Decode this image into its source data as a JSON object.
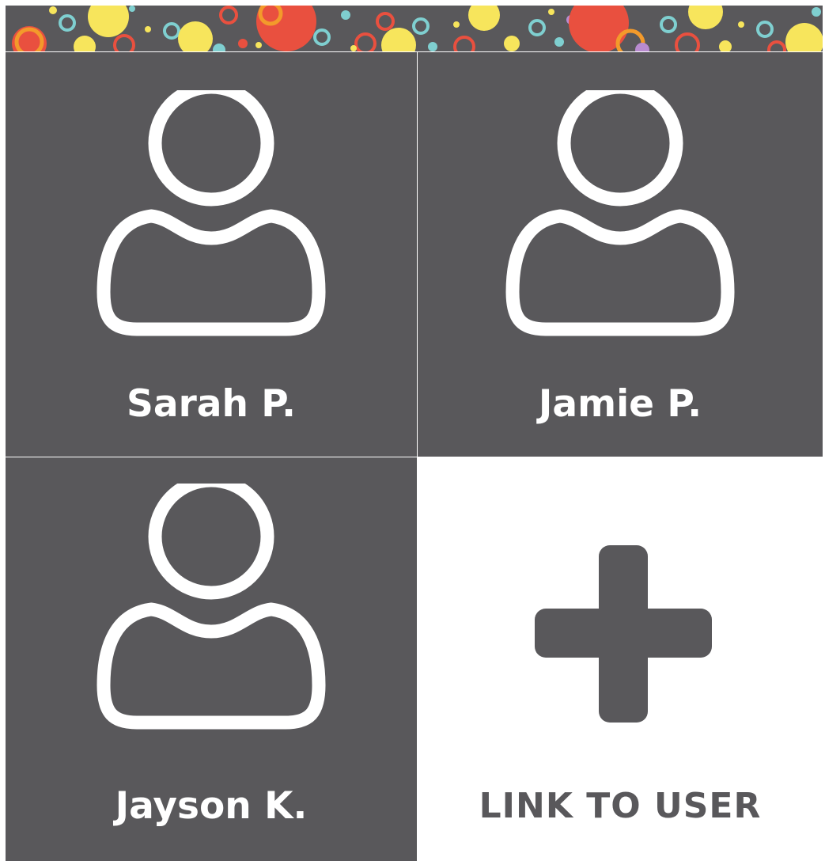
{
  "users": [
    {
      "name": "Sarah P."
    },
    {
      "name": "Jamie P."
    },
    {
      "name": "Jayson K."
    }
  ],
  "add_tile": {
    "label": "LINK TO USER",
    "icon": "plus-icon"
  },
  "colors": {
    "tile_dark": "#59585b",
    "tile_light": "#ffffff",
    "banner_red": "#e9503f",
    "banner_yellow": "#f7e55c",
    "banner_teal": "#7fcfd0",
    "banner_orange": "#f39a2b",
    "banner_purple": "#b98bd0"
  }
}
